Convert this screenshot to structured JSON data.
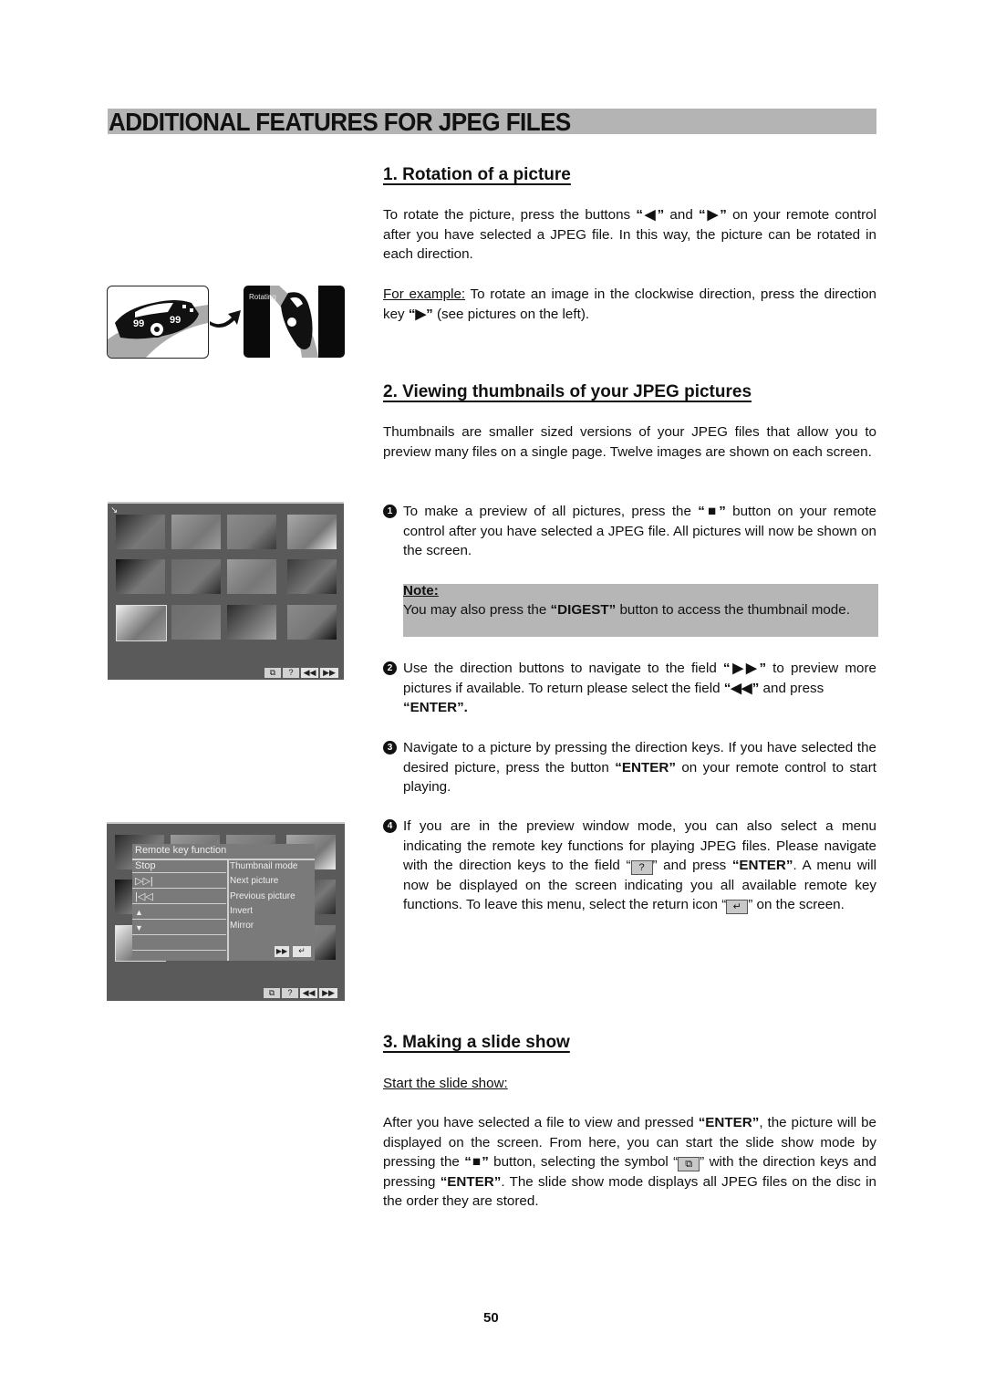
{
  "page": {
    "title": "ADDITIONAL FEATURES FOR JPEG FILES",
    "page_number": "50"
  },
  "section1": {
    "heading": "1. Rotation of a picture",
    "para1": {
      "a": "To rotate the picture, press the buttons ",
      "key_left": "“◀”",
      "b": " and ",
      "key_right": "“▶”",
      "c": " on your remote control after you have selected a JPEG file. In this way, the picture can be rotated in each direction."
    },
    "para2": {
      "label": "For example:",
      "a": " To rotate an image in the clockwise direction, press the direction key ",
      "key": "“▶”",
      "b": " (see pictures on the left)."
    },
    "illustration": {
      "rotating_label": "Rotating",
      "car_number": "99"
    }
  },
  "section2": {
    "heading": "2. Viewing thumbnails of your JPEG pictures",
    "intro": "Thumbnails are smaller sized versions of your JPEG files that allow you to preview many files on a single page. Twelve images are shown on each screen.",
    "steps": [
      {
        "num": "1",
        "a": "To make a preview of all pictures, press the ",
        "key": "“■”",
        "b": " button on your remote control after you have selected a JPEG file. All pictures will now be shown on the screen."
      },
      {
        "num": "2",
        "a": "Use the direction buttons to navigate to the field ",
        "key1": "“▶▶”",
        "b": " to preview more pictures if available. To return please select the field ",
        "key2": "“◀◀”",
        "c": " and press ",
        "key3": "“ENTER”."
      },
      {
        "num": "3",
        "a": "Navigate to a picture by pressing the direction keys. If you have selected the desired picture, press the button ",
        "key": "“ENTER”",
        "b": " on your remote control to start playing."
      },
      {
        "num": "4",
        "a": "If you are in the preview window mode, you can also select a menu indicating the remote key functions for playing JPEG files. Please navigate with the direction keys to the field “",
        "field_icon": "?",
        "b": "” and press ",
        "key": "“ENTER”",
        "c": ". A menu will now be displayed on the screen indicating you all available remote key functions. To leave this menu, select the return icon “",
        "return_icon": "↵",
        "d": "” on the screen."
      }
    ],
    "note": {
      "label": "Note:",
      "a": "You may also press the ",
      "key": "“DIGEST”",
      "b": " button to access the thumbnail mode."
    },
    "screen_toolbar": {
      "slideshow": "⧉",
      "help": "?",
      "prev": "◀◀",
      "next": "▶▶"
    },
    "remote_menu": {
      "title": "Remote key function",
      "rows": [
        {
          "key": "Stop",
          "function": "Thumbnail mode"
        },
        {
          "key": "▷▷|",
          "function": "Next picture"
        },
        {
          "key": "|◁◁",
          "function": "Previous picture"
        },
        {
          "key": "▲",
          "function": "Invert"
        },
        {
          "key": "▼",
          "function": "Mirror"
        }
      ],
      "next_button": "▶▶",
      "return_button": "↵"
    }
  },
  "section3": {
    "heading": "3. Making a slide show",
    "subheading": "Start the slide show:",
    "para": {
      "a": "After you have selected a file to view and pressed ",
      "key1": "“ENTER”",
      "b": ", the picture will be displayed on the screen. From here, you can start the slide show mode by pressing the ",
      "key2": "“■”",
      "c": " button, selecting the symbol “",
      "symbol": "⧉",
      "d": "” with the direction keys and pressing ",
      "key3": "“ENTER”",
      "e": ". The slide show mode displays all JPEG files on the disc in the order they are stored."
    }
  }
}
